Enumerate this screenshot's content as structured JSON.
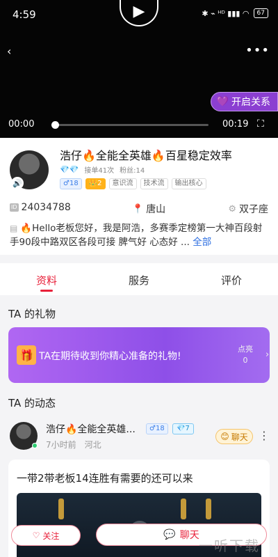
{
  "status_bar": {
    "time": "4:59",
    "icons": "✱ ⌁ ᴴᴰ ▮▮▮ ◠",
    "battery": "67"
  },
  "video": {
    "current_time": "00:00",
    "total_time": "00:19",
    "progress": 0,
    "relation_button": "开启关系"
  },
  "profile": {
    "name": "浩仔🔥全能全英雄🔥百星稳定效率",
    "orders": "接单41次",
    "fans": "粉丝:14",
    "tags": [
      "♂18",
      "👑2",
      "意识流",
      "技术流",
      "输出核心"
    ],
    "id": "24034788",
    "location": "唐山",
    "zodiac": "双子座",
    "bio": "🔥Hello老板您好，我是阿浩，多赛季定榜第一大神百段射手90段中路双区各段可接 脾气好 心态好 ...",
    "bio_more": "全部"
  },
  "tabs": [
    "资料",
    "服务",
    "评价"
  ],
  "gifts": {
    "title": "TA 的礼物",
    "banner_text": "TA在期待收到你精心准备的礼物!",
    "light_label": "点亮",
    "light_count": "0"
  },
  "feed": {
    "title": "TA 的动态",
    "name": "浩仔🔥全能全英雄...",
    "gender_tag": "♂18",
    "level_tag": "7",
    "time": "7小时前",
    "location": "河北",
    "chat_label": "聊天",
    "post_text": "一带2带老板14连胜有需要的还可以来"
  },
  "bottom": {
    "follow": "关注",
    "chat": "聊天"
  },
  "watermark": "一听下载"
}
